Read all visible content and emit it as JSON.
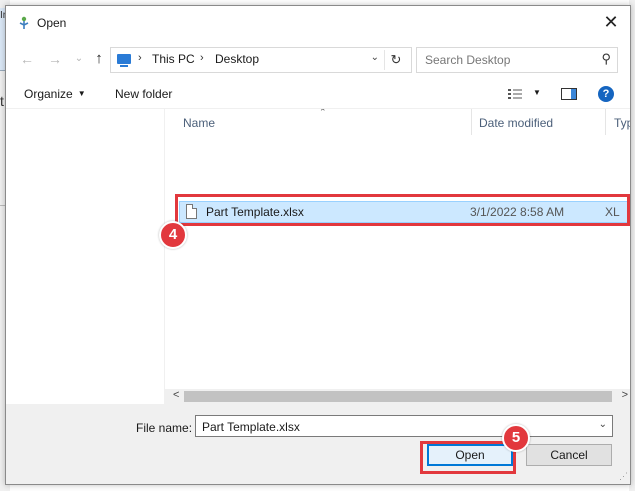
{
  "dialog": {
    "title": "Open",
    "close_symbol": "✕"
  },
  "nav": {
    "back_symbol": "←",
    "forward_symbol": "→",
    "recent_symbol": "⌄",
    "up_symbol": "↑",
    "breadcrumb": [
      "This PC",
      "Desktop"
    ],
    "breadcrumb_sep": "›",
    "dropdown_symbol": "⌄",
    "refresh_symbol": "↻"
  },
  "search": {
    "placeholder": "Search Desktop",
    "icon_symbol": "⚲"
  },
  "toolbar": {
    "organize_label": "Organize",
    "new_folder_label": "New folder",
    "help_symbol": "?"
  },
  "columns": {
    "name": "Name",
    "date_modified": "Date modified",
    "type": "Typ"
  },
  "files": [
    {
      "name": "Part Template.xlsx",
      "date": "3/1/2022 8:58 AM",
      "type": "XL"
    }
  ],
  "bottom": {
    "file_name_label": "File name:",
    "file_name_value": "Part Template.xlsx",
    "open_label": "Open",
    "cancel_label": "Cancel"
  },
  "annotations": {
    "step4": "4",
    "step5": "5",
    "accent_color": "#e2383d"
  },
  "background_app": {
    "fragment_1": "In",
    "fragment_2": "t"
  }
}
